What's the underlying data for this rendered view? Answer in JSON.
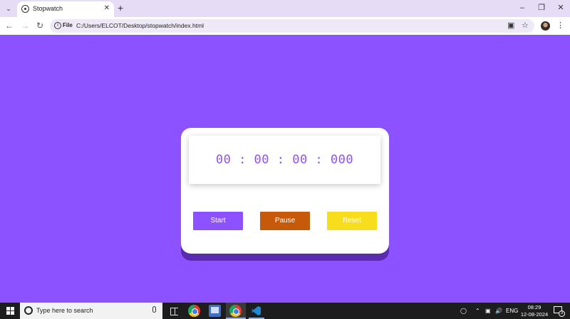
{
  "browser": {
    "tab_list_icon": "chevron-down-icon",
    "tab": {
      "title": "Stopwatch",
      "favicon": "globe-icon",
      "close_icon": "close-icon"
    },
    "new_tab_icon": "plus-icon",
    "window_controls": [
      "minimize-icon",
      "restore-icon",
      "close-icon"
    ],
    "nav": [
      "back-icon",
      "forward-icon",
      "reload-icon"
    ],
    "address": {
      "scheme_label": "File",
      "url": "C:/Users/ELCOT/Desktop/stopwatch/index.html"
    },
    "omnibox_icons": [
      "install-icon",
      "star-icon"
    ],
    "profile": "avatar",
    "menu_icon": "more-vertical-icon"
  },
  "stopwatch": {
    "display": "00 : 00 : 00 : 000",
    "buttons": {
      "start": "Start",
      "pause": "Pause",
      "reset": "Reset"
    },
    "colors": {
      "background": "#8c52ff",
      "card": "#ffffff",
      "card_shadow": "#5a2bb0",
      "digits": "#8c52ff",
      "start": "#8c52ff",
      "pause": "#c65a0a",
      "reset": "#f7dd1c"
    }
  },
  "taskbar": {
    "search_placeholder": "Type here to search",
    "apps": [
      "task-view-icon",
      "chrome-icon",
      "photos-icon",
      "chrome-icon",
      "vscode-icon"
    ],
    "tray": {
      "language": "ENG",
      "time": "08:29",
      "date": "12-08-2024",
      "notification_count": "3"
    }
  }
}
